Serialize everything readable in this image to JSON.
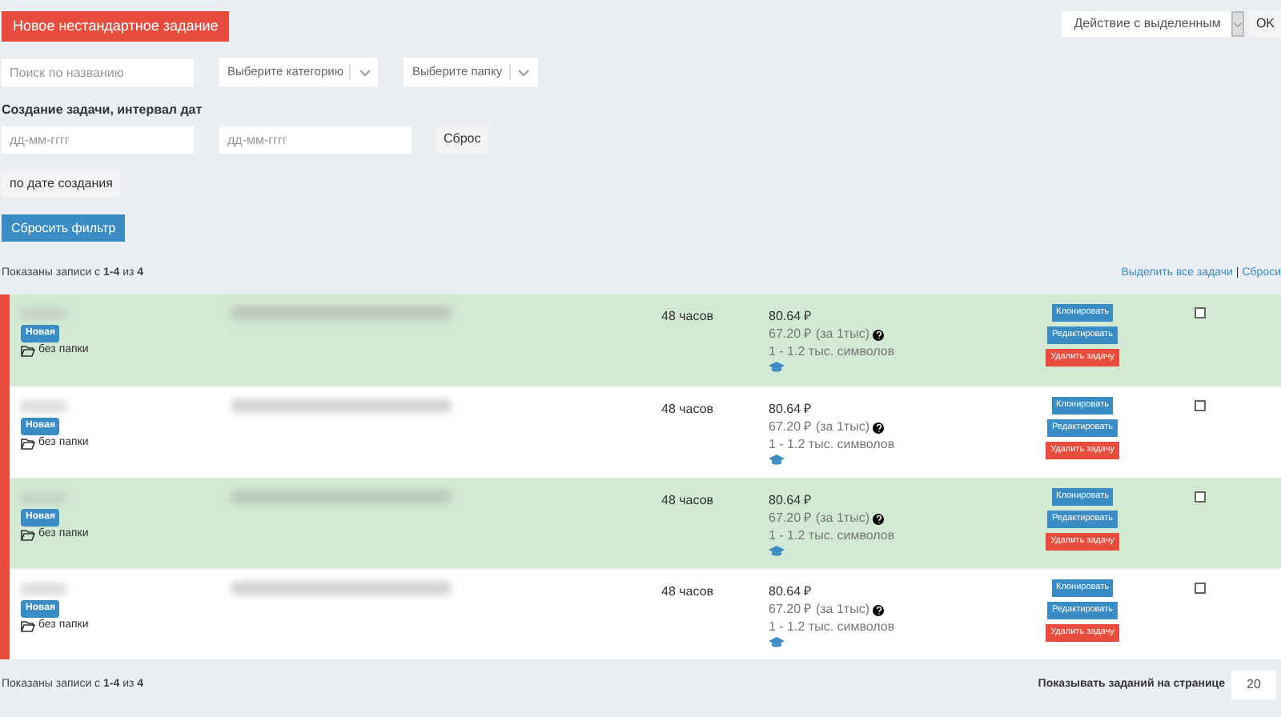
{
  "new_task_button": "Новое нестандартное задание",
  "bulk_action": {
    "value": "Действие с выделенным",
    "ok": "OK"
  },
  "filters": {
    "search_placeholder": "Поиск по названию",
    "category_placeholder": "Выберите категорию",
    "folder_placeholder": "Выберите папку"
  },
  "date_range": {
    "label": "Создание задачи, интервал дат",
    "from_placeholder": "дд-мм-гггг",
    "to_placeholder": "дд-мм-гггг",
    "reset": "Сброс"
  },
  "sort_button": "по дате создания",
  "reset_filter_button": "Сбросить фильтр",
  "summary_top": "Показаны записи с **1-4** из **4**",
  "select_links": [
    "Выделить все задачи",
    "Сброси"
  ],
  "select_links_separator": "|",
  "tasks": [
    {
      "highlighted": true,
      "badge": "Новая",
      "folder": "без папки",
      "deadline": "48 часов",
      "price": "80.64 ₽",
      "rate": "67.20 ₽ (за 1тыс)",
      "length": "1 - 1.2 тыс. символов",
      "actions": [
        "Клонировать",
        "Редактировать",
        "Удалить задачу"
      ],
      "checked": false
    },
    {
      "highlighted": false,
      "badge": "Новая",
      "folder": "без папки",
      "deadline": "48 часов",
      "price": "80.64 ₽",
      "rate": "67.20 ₽ (за 1тыс)",
      "length": "1 - 1.2 тыс. символов",
      "actions": [
        "Клонировать",
        "Редактировать",
        "Удалить задачу"
      ],
      "checked": false
    },
    {
      "highlighted": true,
      "badge": "Новая",
      "folder": "без папки",
      "deadline": "48 часов",
      "price": "80.64 ₽",
      "rate": "67.20 ₽ (за 1тыс)",
      "length": "1 - 1.2 тыс. символов",
      "actions": [
        "Клонировать",
        "Редактировать",
        "Удалить задачу"
      ],
      "checked": false
    },
    {
      "highlighted": false,
      "badge": "Новая",
      "folder": "без папки",
      "deadline": "48 часов",
      "price": "80.64 ₽",
      "rate": "67.20 ₽ (за 1тыс)",
      "length": "1 - 1.2 тыс. символов",
      "actions": [
        "Клонировать",
        "Редактировать",
        "Удалить задачу"
      ],
      "checked": false
    }
  ],
  "summary_bottom": "Показаны записи с **1-4** из **4**",
  "per_page": {
    "label": "Показывать заданий на странице",
    "value": "20"
  }
}
